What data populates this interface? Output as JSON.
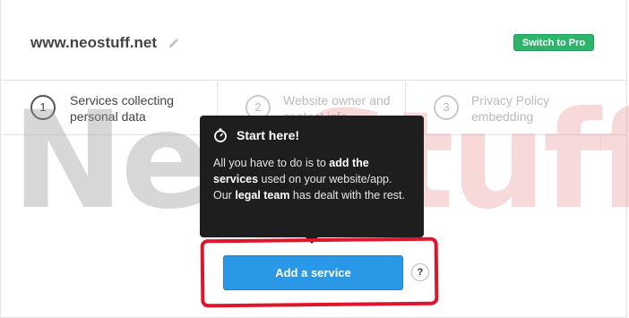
{
  "header": {
    "site_name": "www.neostuff.net",
    "switch_pro_label": "Switch to Pro",
    "edit_icon": "pencil-icon"
  },
  "steps": [
    {
      "number": "1",
      "label": "Services collecting personal data",
      "active": true
    },
    {
      "number": "2",
      "label": "Website owner and contact info",
      "active": false
    },
    {
      "number": "3",
      "label": "Privacy Policy embedding",
      "active": false
    }
  ],
  "watermark": {
    "part1": "Neo",
    "part2": "Stuff"
  },
  "tooltip": {
    "icon": "stopwatch-icon",
    "title": "Start here!",
    "body_1": "All you have to do is to ",
    "body_2": "add the services",
    "body_3": " used on your website/app. Our ",
    "body_4": "legal team",
    "body_5": " has dealt with the rest."
  },
  "actions": {
    "add_service_label": "Add a service",
    "help_label": "?"
  },
  "colors": {
    "pro_button": "#2fb56b",
    "primary_button": "#2a98e6",
    "highlight": "#e0152b",
    "tooltip_bg": "#1e1e1e"
  }
}
